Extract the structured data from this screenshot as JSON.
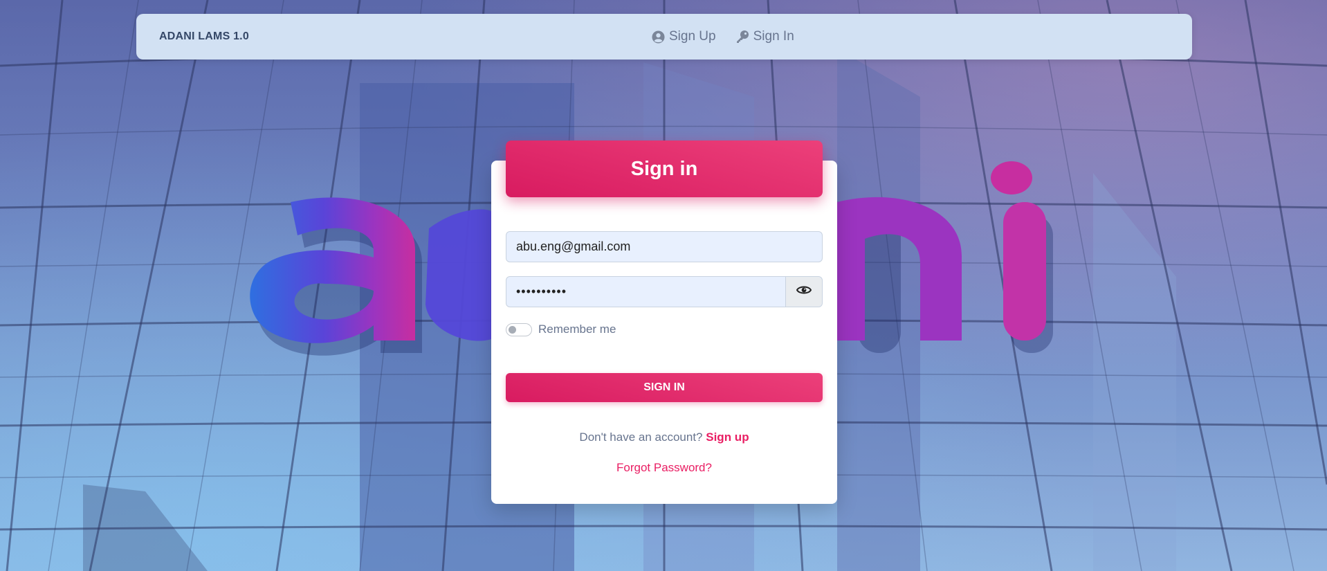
{
  "navbar": {
    "brand": "ADANI LAMS 1.0",
    "links": [
      {
        "label": "Sign Up",
        "icon": "user-circle-icon"
      },
      {
        "label": "Sign In",
        "icon": "key-icon"
      }
    ]
  },
  "background": {
    "logo_text": "adani",
    "colors": {
      "logo_blue": "#2f6fe0",
      "logo_purple": "#9b34c0",
      "logo_magenta": "#c72ea0"
    }
  },
  "login": {
    "title": "Sign in",
    "email_value": "abu.eng@gmail.com",
    "password_value": "••••••••••",
    "show_password_icon": "eye-icon",
    "remember_label": "Remember me",
    "remember_checked": false,
    "submit_label": "SIGN IN",
    "no_account_text": "Don't have an account?",
    "signup_link": "Sign up",
    "forgot_link": "Forgot Password?"
  },
  "colors": {
    "accent": "#e91e63",
    "navbar_bg": "#d2e1f3",
    "text_muted": "#67748e",
    "brand_text": "#344767"
  }
}
